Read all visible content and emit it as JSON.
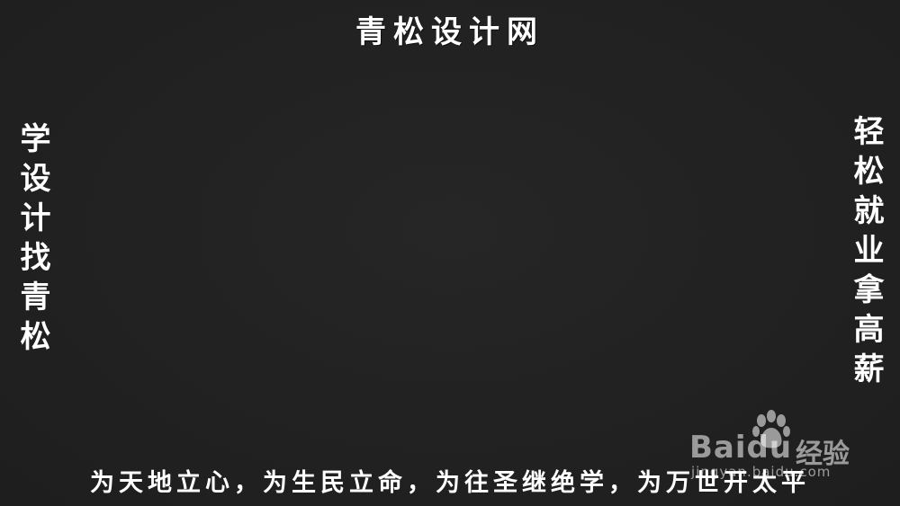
{
  "title": "青松设计网",
  "left_slogan": "学设计找青松",
  "right_slogan": "轻松就业拿高薪",
  "motto": "为天地立心，为生民立命，为往圣继绝学，为万世开太平",
  "watermark": {
    "brand": "Bai",
    "brand_suffix": "du",
    "product": "经验",
    "url": "jingyan.baidu.com",
    "icon": "paw-icon"
  },
  "colors": {
    "background": "#212121",
    "text": "#ffffff"
  }
}
